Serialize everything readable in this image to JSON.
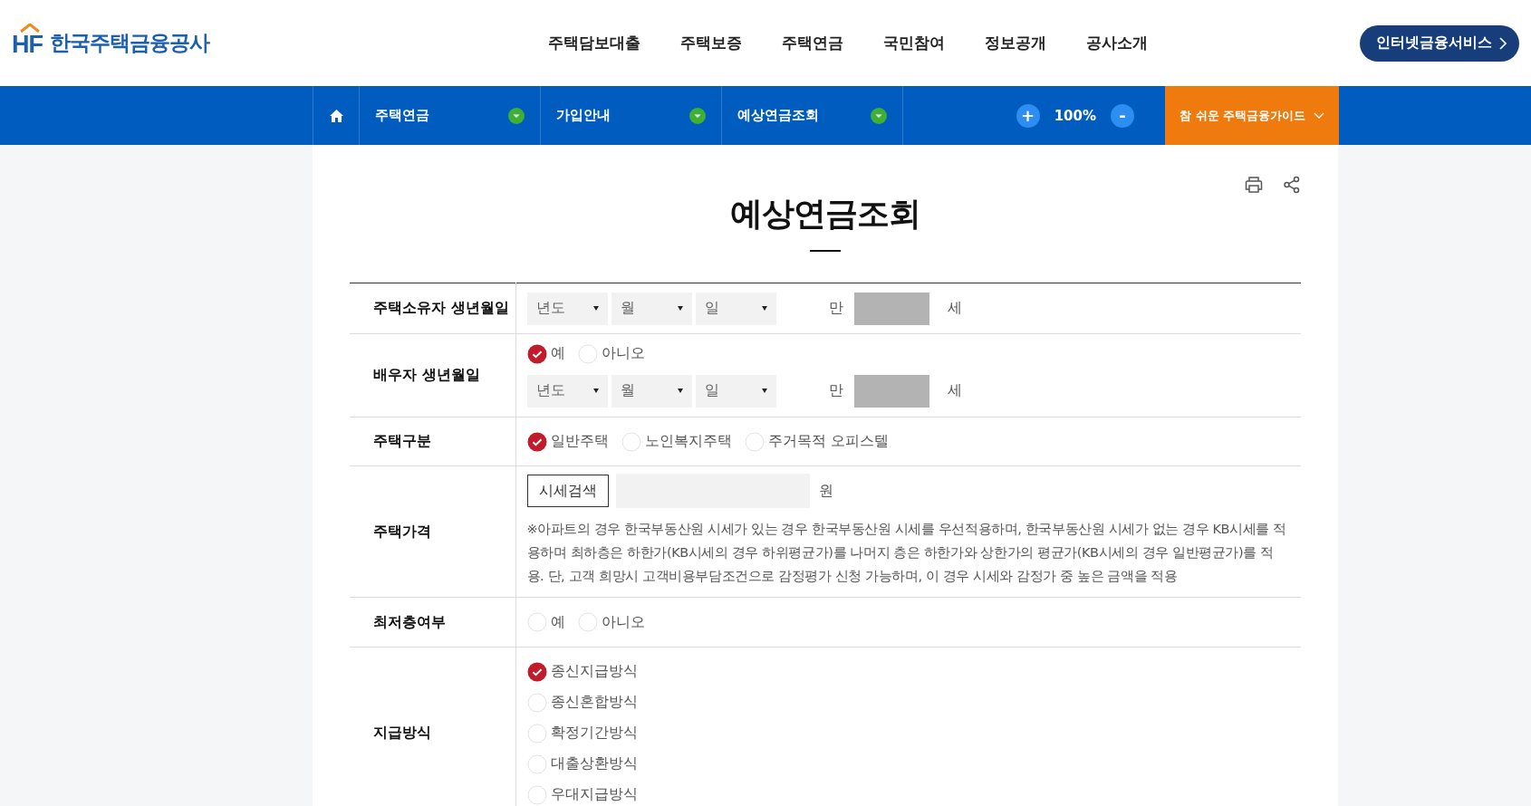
{
  "header": {
    "logo": {
      "mark": "HF",
      "name": "한국주택금융공사"
    },
    "menu": [
      "주택담보대출",
      "주택보증",
      "주택연금",
      "국민참여",
      "정보공개",
      "공사소개"
    ],
    "service_button": "인터넷금융서비스"
  },
  "nav": {
    "crumbs": [
      "주택연금",
      "가입안내",
      "예상연금조회"
    ],
    "zoom": {
      "plus": "+",
      "level": "100%",
      "minus": "-"
    },
    "guide": "참 쉬운 주택금융가이드"
  },
  "page": {
    "title": "예상연금조회"
  },
  "form": [
    {
      "kind": "birth",
      "label": "주택소유자 생년월일",
      "selects": [
        "년도",
        "월",
        "일"
      ],
      "prefix": "만",
      "suffix": "세"
    },
    {
      "kind": "spouse",
      "label": "배우자 생년월일",
      "options": [
        {
          "label": "예",
          "selected": true
        },
        {
          "label": "아니오",
          "selected": false
        }
      ],
      "selects": [
        "년도",
        "월",
        "일"
      ],
      "prefix": "만",
      "suffix": "세"
    },
    {
      "kind": "radio",
      "label": "주택구분",
      "options": [
        {
          "label": "일반주택",
          "selected": true
        },
        {
          "label": "노인복지주택",
          "selected": false
        },
        {
          "label": "주거목적 오피스텔",
          "selected": false
        }
      ]
    },
    {
      "kind": "price",
      "label": "주택가격",
      "button": "시세검색",
      "unit": "원",
      "note": "※아파트의 경우 한국부동산원 시세가 있는 경우 한국부동산원 시세를 우선적용하며, 한국부동산원 시세가 없는 경우 KB시세를 적용하며 최하층은 하한가(KB시세의 경우 하위평균가)를 나머지 층은 하한가와 상한가의 평균가(KB시세의 경우 일반평균가)를 적용. 단, 고객 희망시 고객비용부담조건으로 감정평가 신청 가능하며, 이 경우 시세와 감정가 중 높은 금액을 적용"
    },
    {
      "kind": "radio",
      "label": "최저층여부",
      "options": [
        {
          "label": "예",
          "selected": false
        },
        {
          "label": "아니오",
          "selected": false
        }
      ]
    },
    {
      "kind": "radio-vertical",
      "label": "지급방식",
      "options": [
        {
          "label": "종신지급방식",
          "selected": true
        },
        {
          "label": "종신혼합방식",
          "selected": false
        },
        {
          "label": "확정기간방식",
          "selected": false
        },
        {
          "label": "대출상환방식",
          "selected": false
        },
        {
          "label": "우대지급방식",
          "selected": false
        }
      ]
    }
  ]
}
